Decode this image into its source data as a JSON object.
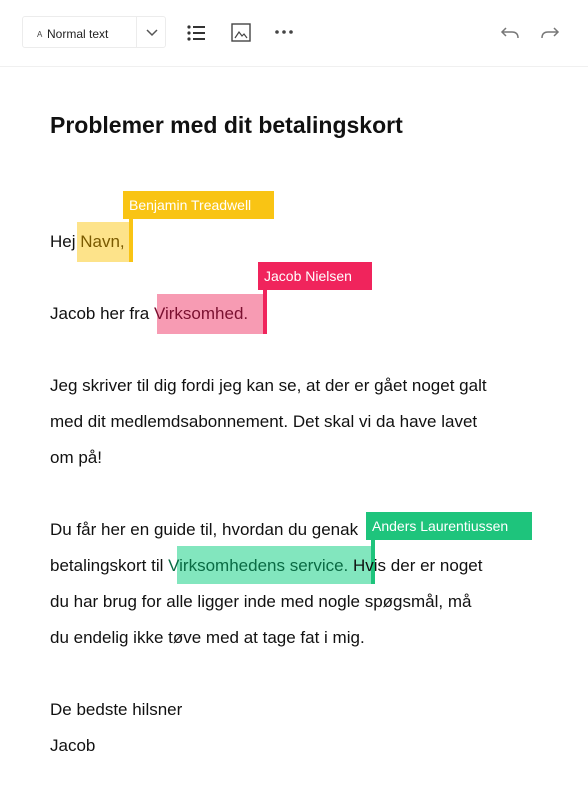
{
  "toolbar": {
    "text_style": "Normal text",
    "text_style_prefix": "A",
    "icons": [
      "chevron-down-icon",
      "bullet-list-icon",
      "image-icon",
      "more-icon",
      "undo-icon",
      "redo-icon"
    ]
  },
  "document": {
    "title": "Problemer med dit betalingskort",
    "greeting_before": "Hej ",
    "greeting_highlight": "Navn,",
    "intro_before": "Jacob her fra ",
    "intro_highlight": "Virksomhed.",
    "p1_line1": "Jeg skriver til dig fordi jeg kan se, at der er gået noget galt",
    "p1_line2": "med dit medlemdsabonnement. Det skal vi da have lavet",
    "p1_line3": "om på!",
    "p2_line1": "Du får her en guide til, hvordan du genak",
    "p2_line2_before": "betalingskort til ",
    "p2_line2_highlight": "Virksomhedens service.",
    "p2_line2_after": " Hvis der er noget",
    "p2_line3": "du har brug for alle ligger inde med nogle spøgsmål, må",
    "p2_line4": "du endelig ikke tøve med at tage fat i mig.",
    "signoff": "De bedste hilsner",
    "signature": "Jacob"
  },
  "collaborators": [
    {
      "name": "Benjamin Treadwell",
      "color": "#f9c414"
    },
    {
      "name": "Jacob Nielsen",
      "color": "#f0245c"
    },
    {
      "name": "Anders Laurentiussen",
      "color": "#1ec47c"
    }
  ]
}
